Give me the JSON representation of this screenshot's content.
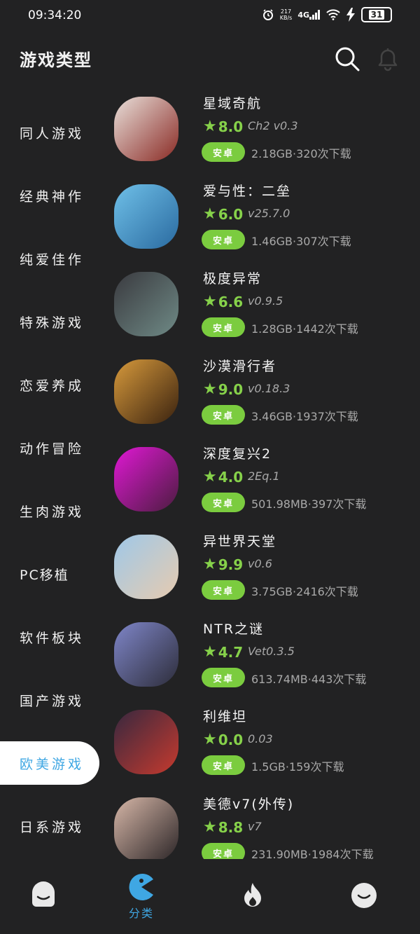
{
  "status": {
    "time": "09:34:20",
    "net_speed": "217",
    "net_unit": "KB/s",
    "net_type": "4G",
    "battery": "31"
  },
  "header": {
    "title": "游戏类型"
  },
  "sidebar": {
    "items": [
      {
        "label": "同人游戏"
      },
      {
        "label": "经典神作"
      },
      {
        "label": "纯爱佳作"
      },
      {
        "label": "特殊游戏"
      },
      {
        "label": "恋爱养成"
      },
      {
        "label": "动作冒险"
      },
      {
        "label": "生肉游戏"
      },
      {
        "label": "PC移植"
      },
      {
        "label": "软件板块"
      },
      {
        "label": "国产游戏"
      },
      {
        "label": "欧美游戏"
      },
      {
        "label": "日系游戏"
      }
    ],
    "active": "欧美游戏"
  },
  "games": [
    {
      "title": "星域奇航",
      "score": "8.0",
      "version": "Ch2 v0.3",
      "platform": "安卓",
      "meta": "2.18GB·320次下载",
      "color_a": "#e9e0db",
      "color_b": "#8a2a24"
    },
    {
      "title": "爱与性：二垒",
      "score": "6.0",
      "version": "v25.7.0",
      "platform": "安卓",
      "meta": "1.46GB·307次下载",
      "color_a": "#6fc0e8",
      "color_b": "#2a6aa0"
    },
    {
      "title": "极度异常",
      "score": "6.6",
      "version": "v0.9.5",
      "platform": "安卓",
      "meta": "1.28GB·1442次下载",
      "color_a": "#3a3a3f",
      "color_b": "#6f8a86"
    },
    {
      "title": "沙漠滑行者",
      "score": "9.0",
      "version": "v0.18.3",
      "platform": "安卓",
      "meta": "3.46GB·1937次下载",
      "color_a": "#d79a3c",
      "color_b": "#3a220f"
    },
    {
      "title": "深度复兴2",
      "score": "4.0",
      "version": "2Eq.1",
      "platform": "安卓",
      "meta": "501.98MB·397次下载",
      "color_a": "#e018d4",
      "color_b": "#4b1c3f"
    },
    {
      "title": "异世界天堂",
      "score": "9.9",
      "version": "v0.6",
      "platform": "安卓",
      "meta": "3.75GB·2416次下载",
      "color_a": "#9fc8e8",
      "color_b": "#e6cbb0"
    },
    {
      "title": "NTR之谜",
      "score": "4.7",
      "version": "Vet0.3.5",
      "platform": "安卓",
      "meta": "613.74MB·443次下载",
      "color_a": "#7f86c9",
      "color_b": "#2d2d3a"
    },
    {
      "title": "利维坦",
      "score": "0.0",
      "version": "0.03",
      "platform": "安卓",
      "meta": "1.5GB·159次下载",
      "color_a": "#37283f",
      "color_b": "#c63a2e"
    },
    {
      "title": "美德v7(外传)",
      "score": "8.8",
      "version": "v7",
      "platform": "安卓",
      "meta": "231.90MB·1984次下载",
      "color_a": "#d7b7a8",
      "color_b": "#2a2426"
    }
  ],
  "nav": {
    "active_label": "分类"
  },
  "colors": {
    "accent": "#3fa7e3",
    "green": "#86d14a",
    "badge": "#7bcc3f",
    "bg": "#222223"
  }
}
